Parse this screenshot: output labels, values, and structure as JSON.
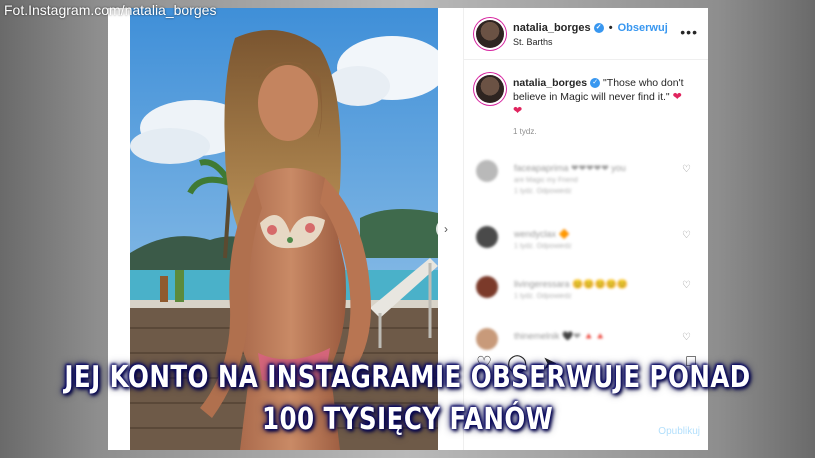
{
  "watermark": "Fot.Instagram.com/natalia_borges",
  "header": {
    "username": "natalia_borges",
    "separator": "•",
    "follow_label": "Obserwuj",
    "location": "St. Barths",
    "more_icon": "more-horizontal-icon"
  },
  "caption": {
    "username": "natalia_borges",
    "text": "\"Those who don't believe in Magic will never find it.\"",
    "emoji": "❤",
    "emoji2": "❤",
    "time": "1 tydz."
  },
  "comments": [
    {
      "name": "faceapaprima ❤❤❤❤❤",
      "text_tail": "you",
      "meta": "1 tydz.   Odpowiedz",
      "second_line": "are Magic my Friend",
      "avatar_color": "#b9b9b9"
    },
    {
      "name": "wendyclax 🔶",
      "meta": "1 tydz.   Odpowiedz",
      "avatar_color": "#4a4a4a"
    },
    {
      "name": "livingeressara 😊😊😊😊😊",
      "meta": "1 tydz.   Odpowiedz",
      "avatar_color": "#7b3a2a"
    },
    {
      "name": "thinemelnik 🖤❤ 🔺🔺",
      "meta": "",
      "avatar_color": "#c89a7a"
    }
  ],
  "actions": {
    "like_icon": "heart-icon",
    "comment_icon": "comment-icon",
    "share_icon": "share-icon",
    "save_icon": "bookmark-icon"
  },
  "publish_label": "Opublikuj",
  "overlay": {
    "line1": "JEJ KONTO NA INSTAGRAMIE OBSERWUJE PONAD",
    "line2": "100 TYSIĘCY FANÓW"
  },
  "colors": {
    "link_blue": "#3897f0",
    "overlay_glow": "#0a0a66",
    "publish_disabled": "#b2dffc"
  }
}
